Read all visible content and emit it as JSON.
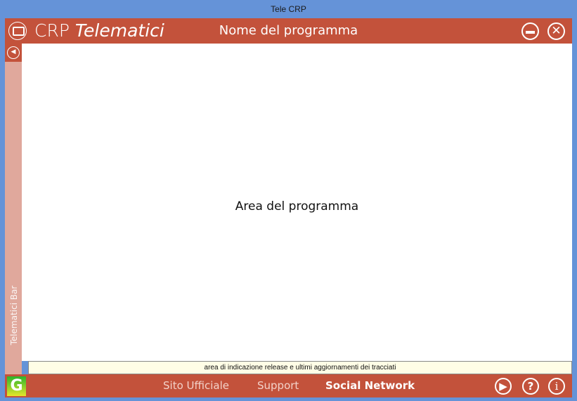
{
  "window": {
    "title": "Tele CRP"
  },
  "header": {
    "brand_plain": "CRP",
    "brand_italic": "Telematici",
    "program_name": "Nome del programma",
    "minimize_icon": "minimize-circle-icon",
    "close_icon": "close-circle-icon"
  },
  "sidebar": {
    "label": "Telematici Bar",
    "back_icon": "back-arrow-icon"
  },
  "main": {
    "placeholder": "Area del programma"
  },
  "status": {
    "text": "area di indicazione release e ultimi aggiornamenti dei tracciati"
  },
  "footer": {
    "logo_text": "G",
    "links": [
      {
        "label": "Sito Ufficiale"
      },
      {
        "label": "Support"
      },
      {
        "label": "Social Network"
      }
    ],
    "icons": [
      "play-icon",
      "help-icon",
      "info-icon"
    ]
  },
  "colors": {
    "accent": "#c3523b",
    "sidebar": "#e0a89c",
    "frame": "#6593d8",
    "status_bg": "#fffde6"
  }
}
